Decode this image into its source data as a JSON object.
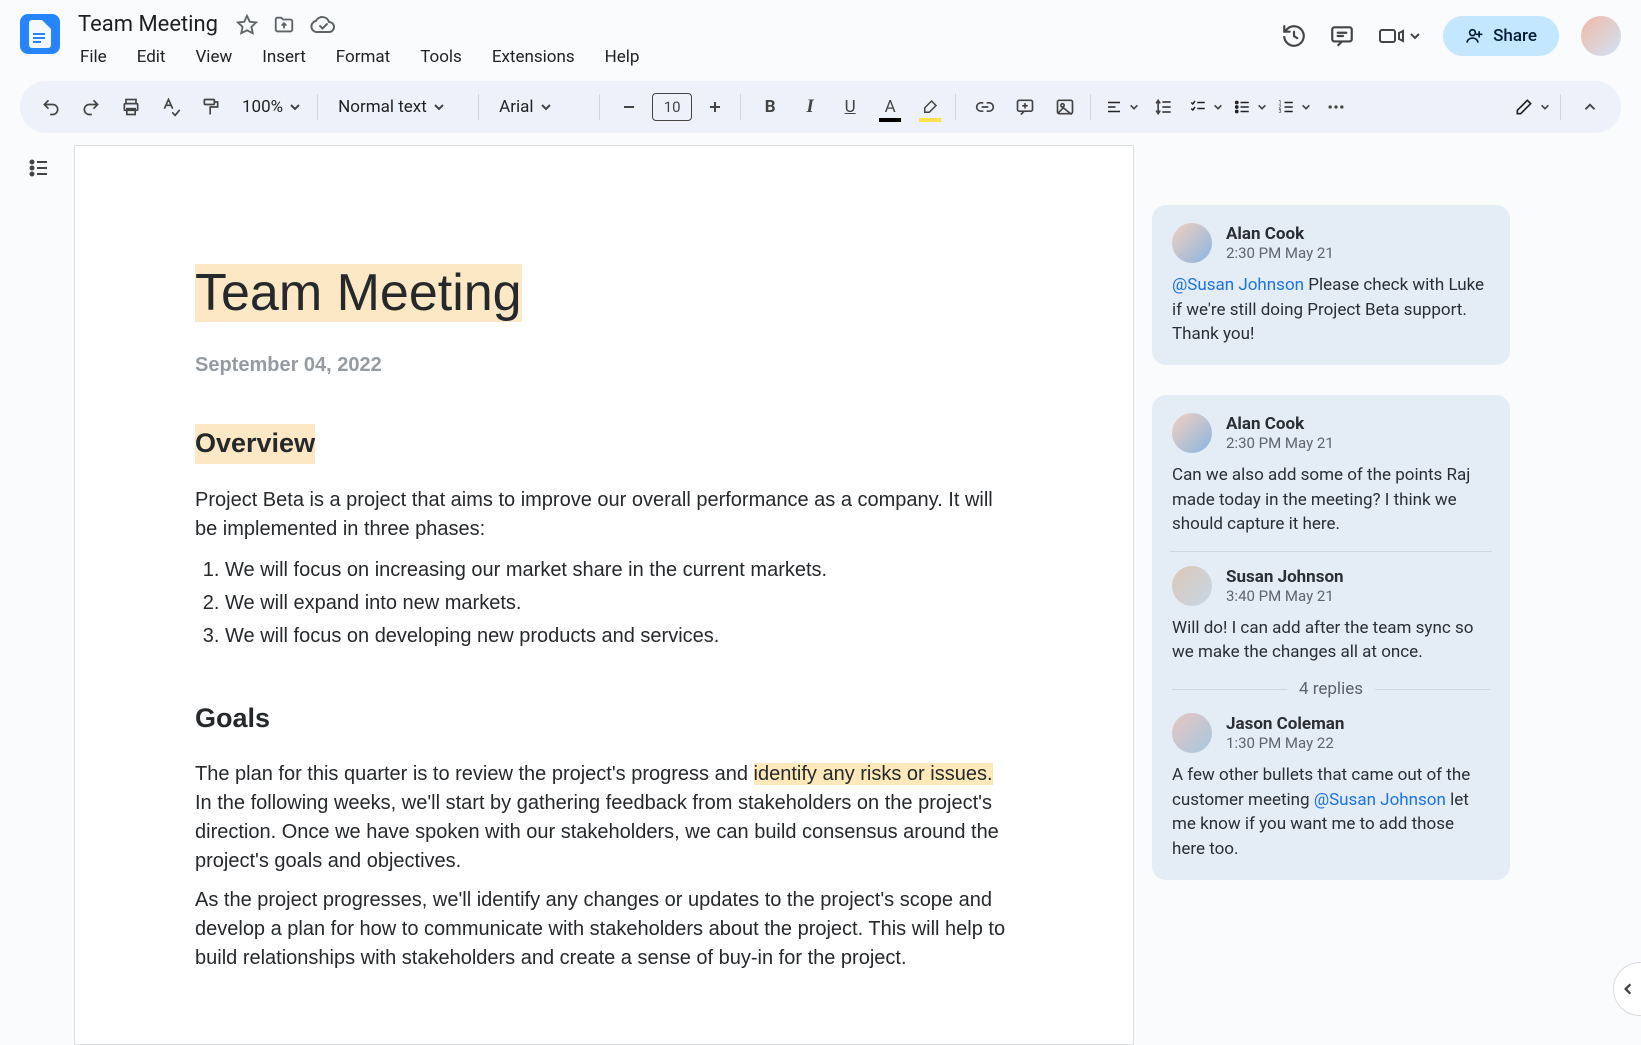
{
  "doc": {
    "title": "Team Meeting"
  },
  "menus": [
    "File",
    "Edit",
    "View",
    "Insert",
    "Format",
    "Tools",
    "Extensions",
    "Help"
  ],
  "share_label": "Share",
  "toolbar": {
    "zoom": "100%",
    "style": "Normal text",
    "font": "Arial",
    "font_size": "10"
  },
  "document": {
    "title": "Team Meeting",
    "date": "September 04, 2022",
    "h_overview": "Overview",
    "overview_para": "Project Beta is a project that aims to improve our overall performance as a company. It will be implemented in three phases:",
    "phase_1": "We will focus on increasing our market share in the current markets.",
    "phase_2": "We will expand into new markets.",
    "phase_3": "We will focus on developing new products and services.",
    "h_goals": "Goals",
    "goals_p1_a": "The plan for this quarter is to review the project's progress and ",
    "goals_p1_hl": "identify any risks or issues.",
    "goals_p1_b": " In the following weeks, we'll start by gathering feedback from stakeholders on the project's direction. Once we have spoken with our stakeholders, we can build consensus around the project's goals and objectives.",
    "goals_p2": "As the project progresses, we'll identify any changes or updates to the project's scope and develop a plan for how to communicate with stakeholders about the project. This will help to build relationships with stakeholders and create a sense of buy-in for the project."
  },
  "comments": {
    "c1": {
      "author": "Alan Cook",
      "time": "2:30 PM May 21",
      "mention": "@Susan Johnson",
      "text": " Please check with Luke if we're still doing Project Beta support. Thank you!"
    },
    "c2": {
      "r1": {
        "author": "Alan Cook",
        "time": "2:30 PM May 21",
        "text": "Can we also add some of the points Raj made today in the meeting? I think we should capture it here."
      },
      "r2": {
        "author": "Susan Johnson",
        "time": "3:40 PM May 21",
        "text": "Will do! I can add after the team sync so we make the changes all at once."
      },
      "replies_label": "4 replies",
      "r3": {
        "author": "Jason Coleman",
        "time": "1:30 PM May 22",
        "text_a": "A few other bullets that came out of the customer meeting ",
        "mention": "@Susan Johnson",
        "text_b": " let me know if you want me to add those here too."
      }
    }
  }
}
